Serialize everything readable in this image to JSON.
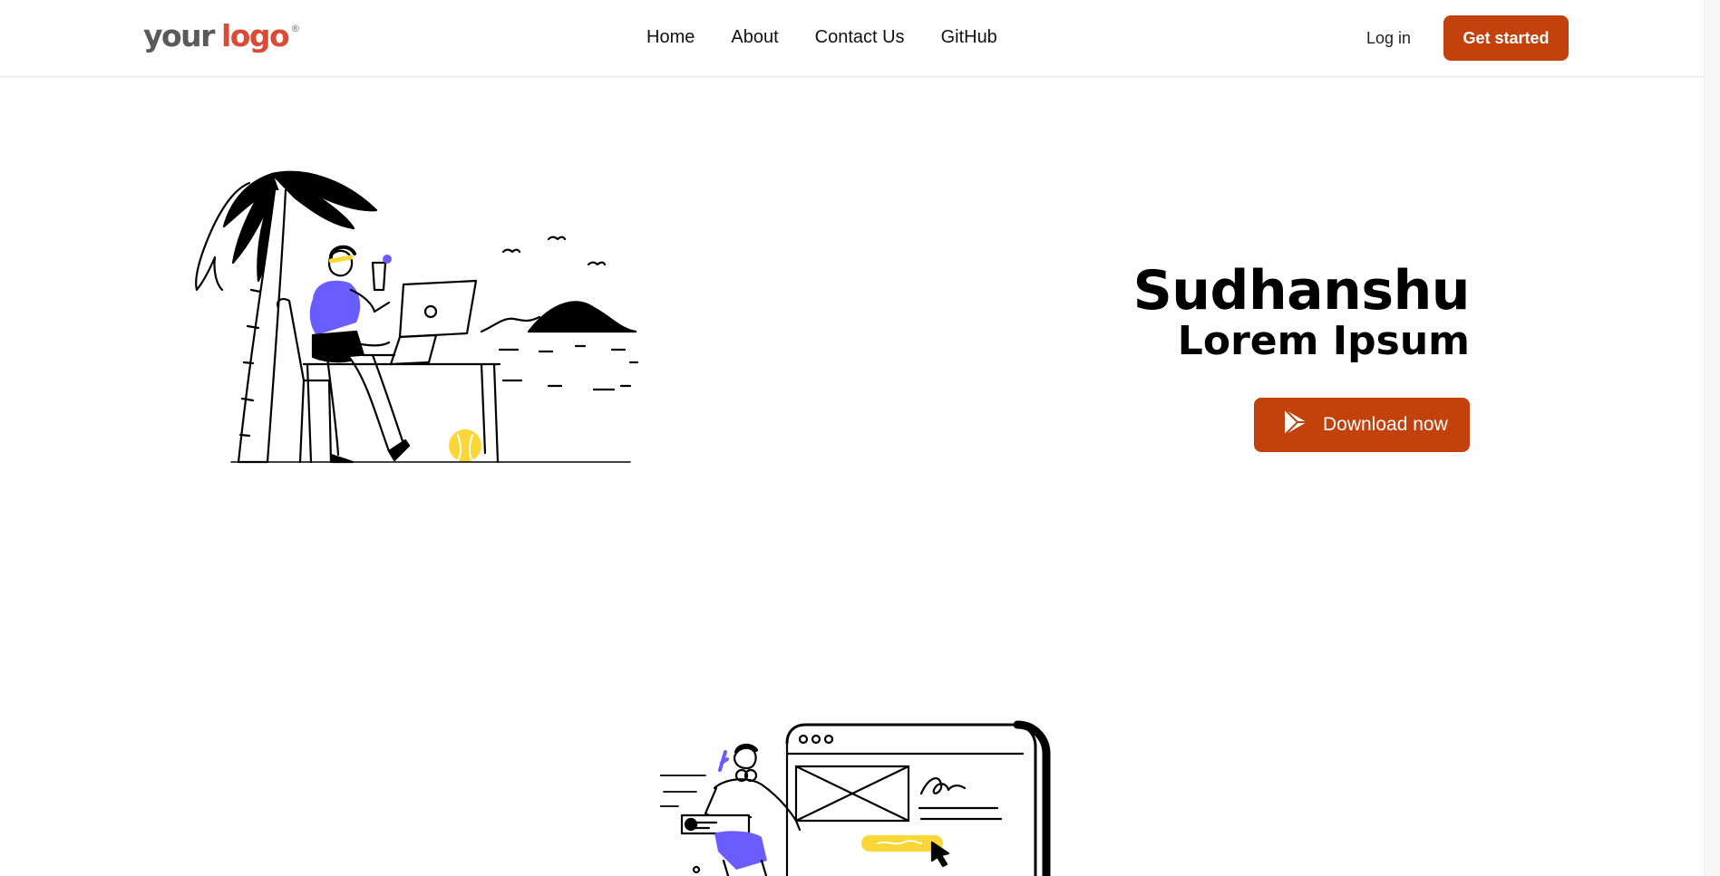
{
  "header": {
    "logo": {
      "word1": "your",
      "word2": "logo",
      "registered": "®",
      "accent_color": "#d94b35"
    },
    "nav": [
      "Home",
      "About",
      "Contact Us",
      "GitHub"
    ],
    "login_label": "Log in",
    "cta_label": "Get started",
    "brand_color": "#c2410c"
  },
  "hero": {
    "title": "Sudhanshu",
    "subtitle": "Lorem Ipsum",
    "download_label": "Download now",
    "download_icon": "play-store-icon"
  },
  "illustrations": {
    "hero": "person-working-on-beach-illustration",
    "secondary": "person-with-website-mockup-illustration",
    "accent_purple": "#6b5cff",
    "accent_yellow": "#fbd637"
  }
}
